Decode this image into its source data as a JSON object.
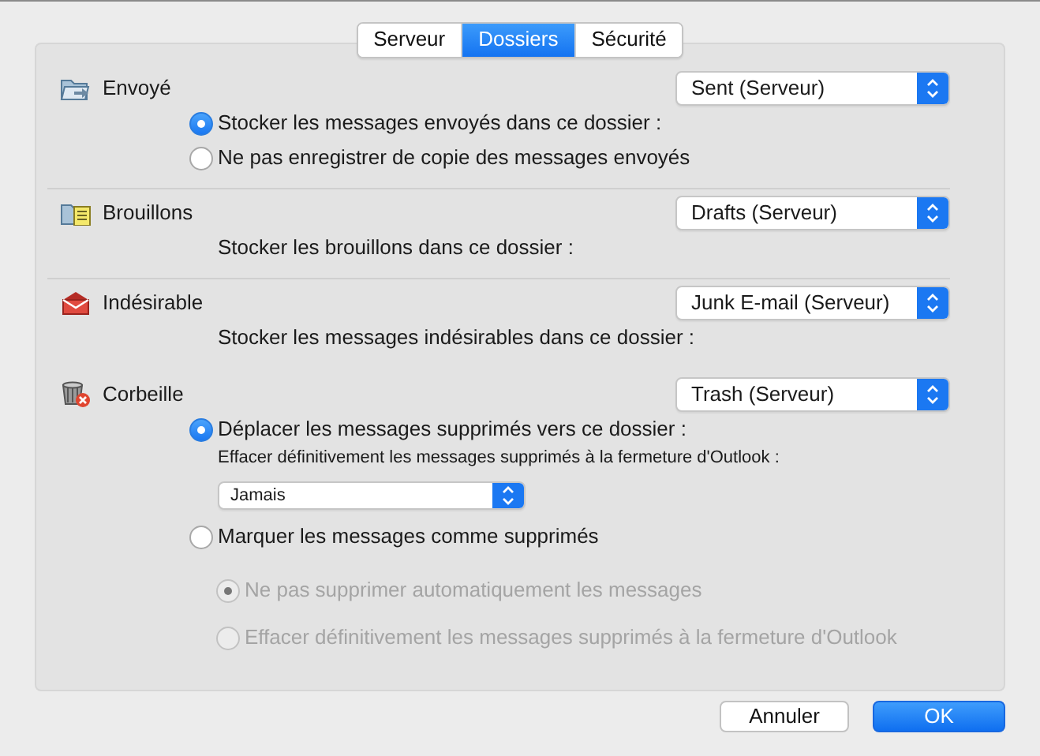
{
  "tabs": [
    {
      "label": "Serveur",
      "selected": false
    },
    {
      "label": "Dossiers",
      "selected": true
    },
    {
      "label": "Sécurité",
      "selected": false
    }
  ],
  "sections": [
    {
      "kind": "sent",
      "label": "Envoyé",
      "folder": "Sent (Serveur)",
      "separator": true,
      "items": [
        {
          "kind": "radio",
          "label": "Stocker les messages envoyés dans ce dossier :",
          "selected": true,
          "disabled": false
        },
        {
          "kind": "radio",
          "label": "Ne pas enregistrer de copie des messages envoyés",
          "selected": false,
          "disabled": false
        }
      ]
    },
    {
      "kind": "drafts",
      "label": "Brouillons",
      "folder": "Drafts (Serveur)",
      "separator": true,
      "items": [
        {
          "kind": "text",
          "label": "Stocker les brouillons dans ce dossier :"
        }
      ]
    },
    {
      "kind": "junk",
      "label": "Indésirable",
      "folder": "Junk E-mail (Serveur)",
      "separator": false,
      "items": [
        {
          "kind": "text",
          "label": "Stocker les messages indésirables dans ce dossier :"
        }
      ]
    },
    {
      "kind": "trash",
      "label": "Corbeille",
      "folder": "Trash (Serveur)",
      "separator": false,
      "items": [
        {
          "kind": "radio",
          "label": "Déplacer les messages supprimés vers ce dossier :",
          "selected": true,
          "disabled": false
        },
        {
          "kind": "caption",
          "label": "Effacer définitivement les messages supprimés à la fermeture d'Outlook :"
        },
        {
          "kind": "select",
          "value": "Jamais"
        },
        {
          "kind": "radio",
          "label": "Marquer les messages comme supprimés",
          "selected": false,
          "disabled": false,
          "children": [
            {
              "kind": "radio",
              "label": "Ne pas supprimer automatiquement les messages",
              "selected": true,
              "disabled": true
            },
            {
              "kind": "radio",
              "label": "Effacer définitivement les messages supprimés à la fermeture d'Outlook",
              "selected": false,
              "disabled": true
            }
          ]
        }
      ]
    }
  ],
  "buttons": [
    {
      "label": "Annuler",
      "primary": false
    },
    {
      "label": "OK",
      "primary": true
    }
  ]
}
